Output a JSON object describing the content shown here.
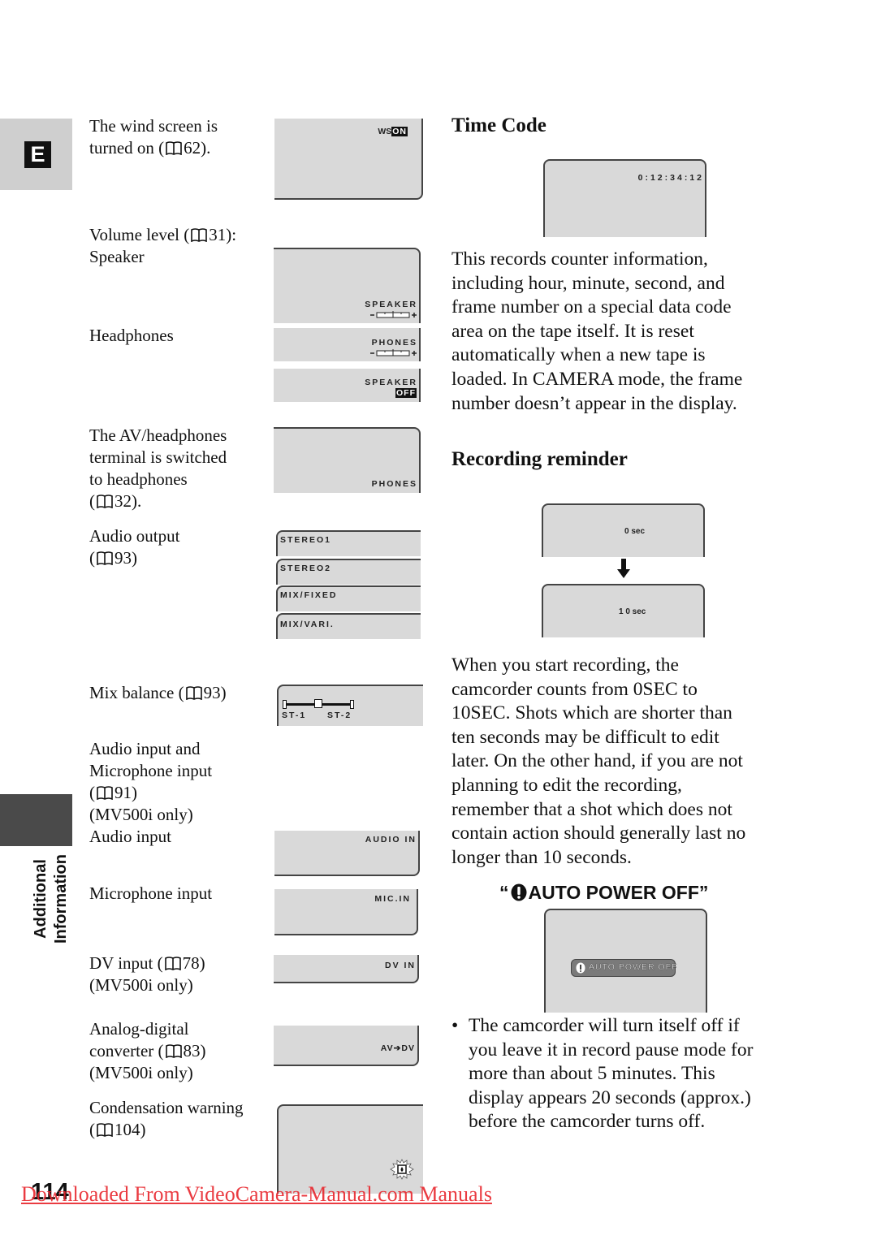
{
  "sidebar": {
    "language_tab": "E",
    "section_label_line1": "Additional",
    "section_label_line2": "Information"
  },
  "left_column": {
    "wind_screen": {
      "line1": "The wind screen is",
      "line2_pre": "turned on (",
      "page": "62).",
      "display": {
        "prefix": "WS",
        "inverted": "ON"
      }
    },
    "volume_level": {
      "line1_pre": "Volume level (",
      "page": "31):",
      "line2": "Speaker",
      "display_speaker": "SPEAKER"
    },
    "headphones": {
      "label": "Headphones",
      "display_phones": "PHONES",
      "display_speaker_off": "SPEAKER",
      "display_off": "OFF"
    },
    "av_headphones": {
      "line1": "The AV/headphones",
      "line2": "terminal is switched",
      "line3": "to headphones",
      "line4_pre": "(",
      "page": "32).",
      "display": "PHONES"
    },
    "audio_output": {
      "line1": "Audio output",
      "line2_pre": "(",
      "page": "93)",
      "options": [
        "STEREO1",
        "STEREO2",
        "MIX/FIXED",
        "MIX/VARI."
      ]
    },
    "mix_balance": {
      "label_pre": "Mix balance (",
      "page": "93)",
      "left": "ST-1",
      "right": "ST-2",
      "position": 0.5
    },
    "audio_input_heading": {
      "line1": "Audio input and",
      "line2": "Microphone input",
      "line3_pre": "(",
      "page": "91)",
      "line4": "(MV500i only)"
    },
    "audio_input": {
      "label": "Audio input",
      "display": "AUDIO IN"
    },
    "microphone_input": {
      "label": "Microphone input",
      "display": "MIC.IN"
    },
    "dv_input": {
      "line1_pre": "DV input (",
      "page": "78)",
      "line2": "(MV500i only)",
      "display": "DV IN"
    },
    "analog_digital": {
      "line1": "Analog-digital",
      "line2_pre": "converter (",
      "page": "83)",
      "line3": "(MV500i only)",
      "display": "AV➔DV"
    },
    "condensation": {
      "line1": "Condensation warning",
      "line2_pre": "(",
      "page": "104)"
    }
  },
  "right_column": {
    "time_code": {
      "heading": "Time Code",
      "display": "0:12:34:12",
      "paragraph": [
        "This records counter information,",
        "including hour, minute, second, and",
        "frame number on a special data code",
        "area on the tape itself. It is reset",
        "automatically when a new tape is",
        "loaded. In CAMERA mode, the frame",
        "number doesn’t appear in the display."
      ]
    },
    "recording_reminder": {
      "heading": "Recording reminder",
      "display_start": "0 sec",
      "display_end": "1 0 sec",
      "paragraph": [
        "When you start recording, the",
        "camcorder counts from 0SEC to",
        "10SEC. Shots which are shorter than",
        "ten seconds may be difficult to edit",
        "later. On the other hand, if you are not",
        "planning to edit the recording,",
        "remember that a shot which does not",
        "contain action should generally last no",
        "longer than 10 seconds."
      ]
    },
    "auto_power_off": {
      "heading_open": "“",
      "heading_text": "AUTO POWER OFF",
      "heading_close": "”",
      "display": "AUTO POWER OFF",
      "bullet": "•",
      "bullet_text": [
        "The camcorder will turn itself off if",
        "you leave it in record pause mode for",
        "more than about 5 minutes. This",
        "display appears 20 seconds (approx.)",
        "before the camcorder turns off."
      ]
    }
  },
  "footer": {
    "page_number": "114",
    "download_link": "Downloaded From VideoCamera-Manual.com Manuals",
    "link_color": "#e8262d"
  }
}
